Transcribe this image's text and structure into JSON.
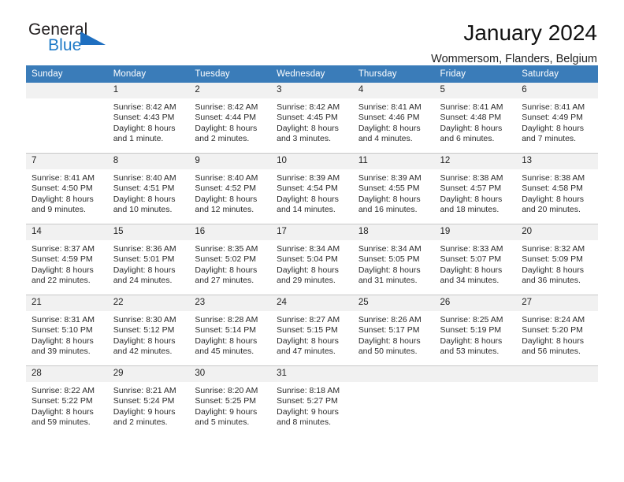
{
  "brand": {
    "name_dark": "General",
    "name_blue": "Blue",
    "dark_color": "#231f20",
    "blue_color": "#1f7ac7",
    "triangle_color": "#1f6fc0"
  },
  "header": {
    "title": "January 2024",
    "subtitle": "Wommersom, Flanders, Belgium"
  },
  "calendar": {
    "header_bg": "#3a7cb9",
    "daynum_bg": "#f1f1f1",
    "weekdays": [
      "Sunday",
      "Monday",
      "Tuesday",
      "Wednesday",
      "Thursday",
      "Friday",
      "Saturday"
    ],
    "weeks": [
      [
        {
          "day": "",
          "lines": []
        },
        {
          "day": "1",
          "lines": [
            "Sunrise: 8:42 AM",
            "Sunset: 4:43 PM",
            "Daylight: 8 hours",
            "and 1 minute."
          ]
        },
        {
          "day": "2",
          "lines": [
            "Sunrise: 8:42 AM",
            "Sunset: 4:44 PM",
            "Daylight: 8 hours",
            "and 2 minutes."
          ]
        },
        {
          "day": "3",
          "lines": [
            "Sunrise: 8:42 AM",
            "Sunset: 4:45 PM",
            "Daylight: 8 hours",
            "and 3 minutes."
          ]
        },
        {
          "day": "4",
          "lines": [
            "Sunrise: 8:41 AM",
            "Sunset: 4:46 PM",
            "Daylight: 8 hours",
            "and 4 minutes."
          ]
        },
        {
          "day": "5",
          "lines": [
            "Sunrise: 8:41 AM",
            "Sunset: 4:48 PM",
            "Daylight: 8 hours",
            "and 6 minutes."
          ]
        },
        {
          "day": "6",
          "lines": [
            "Sunrise: 8:41 AM",
            "Sunset: 4:49 PM",
            "Daylight: 8 hours",
            "and 7 minutes."
          ]
        }
      ],
      [
        {
          "day": "7",
          "lines": [
            "Sunrise: 8:41 AM",
            "Sunset: 4:50 PM",
            "Daylight: 8 hours",
            "and 9 minutes."
          ]
        },
        {
          "day": "8",
          "lines": [
            "Sunrise: 8:40 AM",
            "Sunset: 4:51 PM",
            "Daylight: 8 hours",
            "and 10 minutes."
          ]
        },
        {
          "day": "9",
          "lines": [
            "Sunrise: 8:40 AM",
            "Sunset: 4:52 PM",
            "Daylight: 8 hours",
            "and 12 minutes."
          ]
        },
        {
          "day": "10",
          "lines": [
            "Sunrise: 8:39 AM",
            "Sunset: 4:54 PM",
            "Daylight: 8 hours",
            "and 14 minutes."
          ]
        },
        {
          "day": "11",
          "lines": [
            "Sunrise: 8:39 AM",
            "Sunset: 4:55 PM",
            "Daylight: 8 hours",
            "and 16 minutes."
          ]
        },
        {
          "day": "12",
          "lines": [
            "Sunrise: 8:38 AM",
            "Sunset: 4:57 PM",
            "Daylight: 8 hours",
            "and 18 minutes."
          ]
        },
        {
          "day": "13",
          "lines": [
            "Sunrise: 8:38 AM",
            "Sunset: 4:58 PM",
            "Daylight: 8 hours",
            "and 20 minutes."
          ]
        }
      ],
      [
        {
          "day": "14",
          "lines": [
            "Sunrise: 8:37 AM",
            "Sunset: 4:59 PM",
            "Daylight: 8 hours",
            "and 22 minutes."
          ]
        },
        {
          "day": "15",
          "lines": [
            "Sunrise: 8:36 AM",
            "Sunset: 5:01 PM",
            "Daylight: 8 hours",
            "and 24 minutes."
          ]
        },
        {
          "day": "16",
          "lines": [
            "Sunrise: 8:35 AM",
            "Sunset: 5:02 PM",
            "Daylight: 8 hours",
            "and 27 minutes."
          ]
        },
        {
          "day": "17",
          "lines": [
            "Sunrise: 8:34 AM",
            "Sunset: 5:04 PM",
            "Daylight: 8 hours",
            "and 29 minutes."
          ]
        },
        {
          "day": "18",
          "lines": [
            "Sunrise: 8:34 AM",
            "Sunset: 5:05 PM",
            "Daylight: 8 hours",
            "and 31 minutes."
          ]
        },
        {
          "day": "19",
          "lines": [
            "Sunrise: 8:33 AM",
            "Sunset: 5:07 PM",
            "Daylight: 8 hours",
            "and 34 minutes."
          ]
        },
        {
          "day": "20",
          "lines": [
            "Sunrise: 8:32 AM",
            "Sunset: 5:09 PM",
            "Daylight: 8 hours",
            "and 36 minutes."
          ]
        }
      ],
      [
        {
          "day": "21",
          "lines": [
            "Sunrise: 8:31 AM",
            "Sunset: 5:10 PM",
            "Daylight: 8 hours",
            "and 39 minutes."
          ]
        },
        {
          "day": "22",
          "lines": [
            "Sunrise: 8:30 AM",
            "Sunset: 5:12 PM",
            "Daylight: 8 hours",
            "and 42 minutes."
          ]
        },
        {
          "day": "23",
          "lines": [
            "Sunrise: 8:28 AM",
            "Sunset: 5:14 PM",
            "Daylight: 8 hours",
            "and 45 minutes."
          ]
        },
        {
          "day": "24",
          "lines": [
            "Sunrise: 8:27 AM",
            "Sunset: 5:15 PM",
            "Daylight: 8 hours",
            "and 47 minutes."
          ]
        },
        {
          "day": "25",
          "lines": [
            "Sunrise: 8:26 AM",
            "Sunset: 5:17 PM",
            "Daylight: 8 hours",
            "and 50 minutes."
          ]
        },
        {
          "day": "26",
          "lines": [
            "Sunrise: 8:25 AM",
            "Sunset: 5:19 PM",
            "Daylight: 8 hours",
            "and 53 minutes."
          ]
        },
        {
          "day": "27",
          "lines": [
            "Sunrise: 8:24 AM",
            "Sunset: 5:20 PM",
            "Daylight: 8 hours",
            "and 56 minutes."
          ]
        }
      ],
      [
        {
          "day": "28",
          "lines": [
            "Sunrise: 8:22 AM",
            "Sunset: 5:22 PM",
            "Daylight: 8 hours",
            "and 59 minutes."
          ]
        },
        {
          "day": "29",
          "lines": [
            "Sunrise: 8:21 AM",
            "Sunset: 5:24 PM",
            "Daylight: 9 hours",
            "and 2 minutes."
          ]
        },
        {
          "day": "30",
          "lines": [
            "Sunrise: 8:20 AM",
            "Sunset: 5:25 PM",
            "Daylight: 9 hours",
            "and 5 minutes."
          ]
        },
        {
          "day": "31",
          "lines": [
            "Sunrise: 8:18 AM",
            "Sunset: 5:27 PM",
            "Daylight: 9 hours",
            "and 8 minutes."
          ]
        },
        {
          "day": "",
          "lines": []
        },
        {
          "day": "",
          "lines": []
        },
        {
          "day": "",
          "lines": []
        }
      ]
    ]
  }
}
